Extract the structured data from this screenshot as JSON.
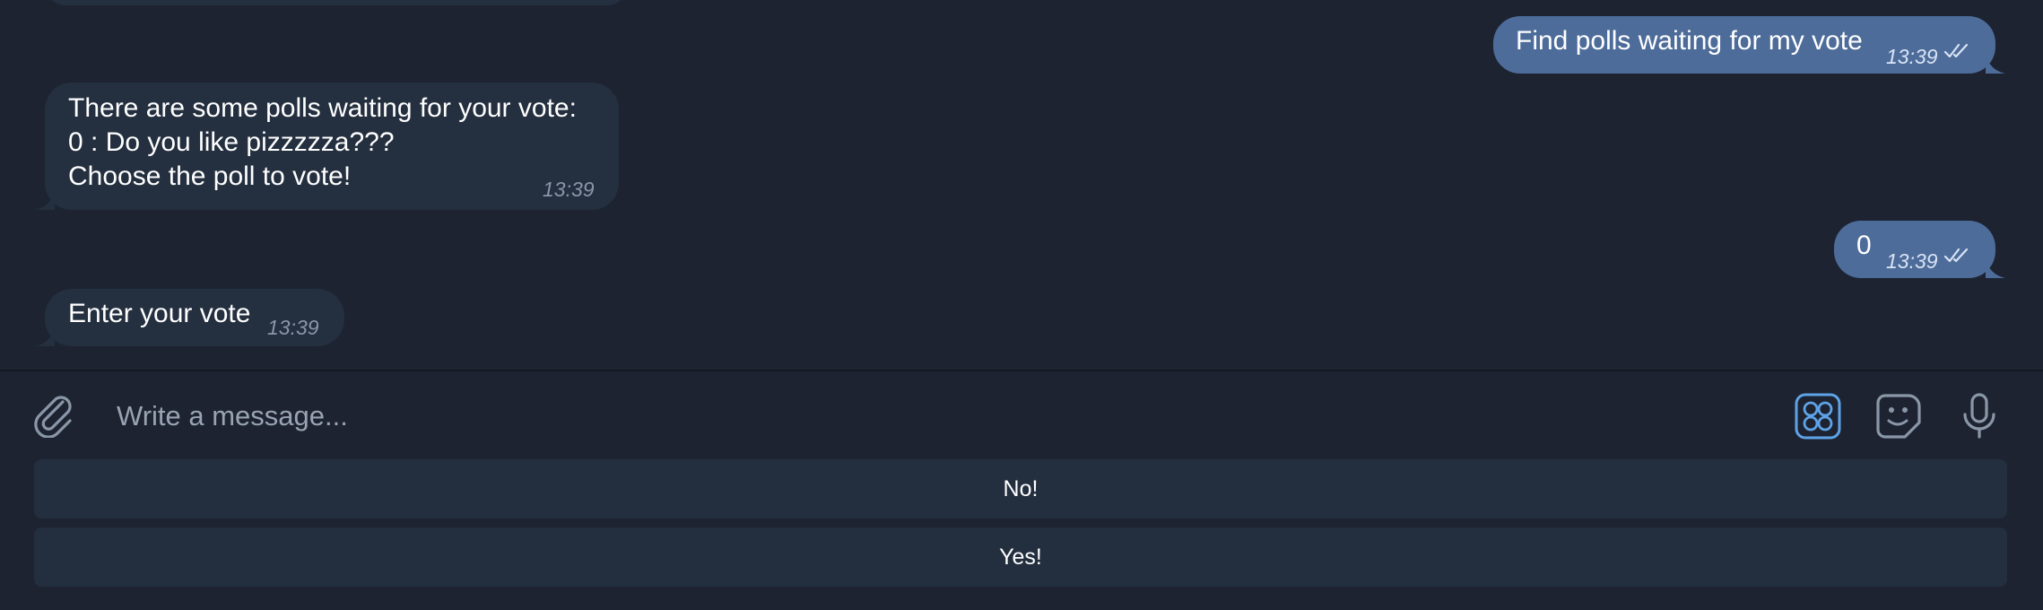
{
  "messages": [
    {
      "direction": "outgoing",
      "text": "Find polls waiting for my vote",
      "time": "13:39",
      "read": true
    },
    {
      "direction": "incoming",
      "lines": [
        "There are some polls waiting for your vote:",
        "0 : Do you like pizzzzza???",
        "Choose the poll to vote!"
      ],
      "time": "13:39"
    },
    {
      "direction": "outgoing",
      "text": "0",
      "time": "13:39",
      "read": true
    },
    {
      "direction": "incoming",
      "text": "Enter your vote",
      "time": "13:39"
    }
  ],
  "composer": {
    "placeholder": "Write a message...",
    "icons": [
      "paperclip-icon",
      "bot-keyboard-icon",
      "sticker-icon",
      "microphone-icon"
    ],
    "accent": "#5ea3e8"
  },
  "keyboard": {
    "buttons": [
      {
        "label": "No!"
      },
      {
        "label": "Yes!"
      }
    ]
  },
  "colors": {
    "background": "#1d2330",
    "incoming_bubble": "#242f3f",
    "outgoing_bubble": "#4d6c9a",
    "keyboard_button": "#232e3e"
  }
}
